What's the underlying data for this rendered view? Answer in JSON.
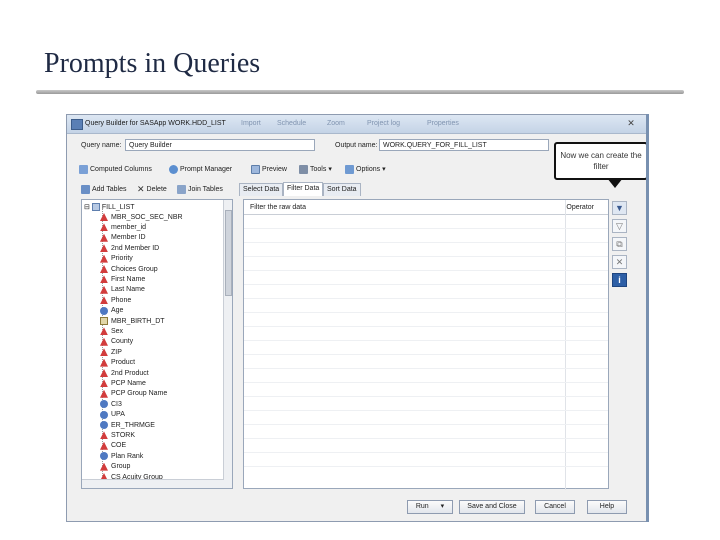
{
  "slide": {
    "title": "Prompts in Queries"
  },
  "window": {
    "title": "Query Builder for SASApp WORK.HDD_LIST",
    "titlebar_items": [
      "Import",
      "Schedule",
      "Zoom",
      "Project log",
      "Properties"
    ],
    "close": "✕"
  },
  "names": {
    "query_label": "Query name:",
    "query_value": "Query Builder",
    "output_label": "Output name:",
    "output_value": "WORK.QUERY_FOR_FILL_LIST"
  },
  "toolbar": {
    "computed_columns": "Computed Columns",
    "prompt_manager": "Prompt Manager",
    "preview": "Preview",
    "tools": "Tools",
    "options": "Options"
  },
  "callout": {
    "text": "Now we can create the filter"
  },
  "left_tabs": {
    "add_tables": "Add Tables",
    "delete": "Delete",
    "join_tables": "Join Tables"
  },
  "tree": {
    "root": "FILL_LIST",
    "items": [
      {
        "label": "MBR_SOC_SEC_NBR",
        "type": "char"
      },
      {
        "label": "member_id",
        "type": "char"
      },
      {
        "label": "Member ID",
        "type": "char"
      },
      {
        "label": "2nd Member ID",
        "type": "char"
      },
      {
        "label": "Priority",
        "type": "char"
      },
      {
        "label": "Choices Group",
        "type": "char"
      },
      {
        "label": "First Name",
        "type": "char"
      },
      {
        "label": "Last Name",
        "type": "char"
      },
      {
        "label": "Phone",
        "type": "char"
      },
      {
        "label": "Age",
        "type": "num"
      },
      {
        "label": "MBR_BIRTH_DT",
        "type": "date"
      },
      {
        "label": "Sex",
        "type": "char"
      },
      {
        "label": "County",
        "type": "char"
      },
      {
        "label": "ZIP",
        "type": "char"
      },
      {
        "label": "Product",
        "type": "char"
      },
      {
        "label": "2nd Product",
        "type": "char"
      },
      {
        "label": "PCP Name",
        "type": "char"
      },
      {
        "label": "PCP Group Name",
        "type": "char"
      },
      {
        "label": "CI3",
        "type": "num"
      },
      {
        "label": "UPA",
        "type": "num"
      },
      {
        "label": "ER_THRMGE",
        "type": "num"
      },
      {
        "label": "STORK",
        "type": "char"
      },
      {
        "label": "COE",
        "type": "char"
      },
      {
        "label": "Plan Rank",
        "type": "num"
      },
      {
        "label": "Group",
        "type": "char"
      },
      {
        "label": "CS Acuity Group",
        "type": "char"
      }
    ]
  },
  "right_tabs": [
    "Select Data",
    "Filter Data",
    "Sort Data"
  ],
  "filter_panel": {
    "col1": "Filter the raw data",
    "col2": "Operator"
  },
  "side_buttons": [
    "new-filter-icon",
    "edit-filter-icon",
    "copy-filter-icon",
    "delete-filter-icon",
    "info-icon"
  ],
  "buttons": {
    "run": "Run",
    "save_close": "Save and Close",
    "cancel": "Cancel",
    "help": "Help"
  }
}
